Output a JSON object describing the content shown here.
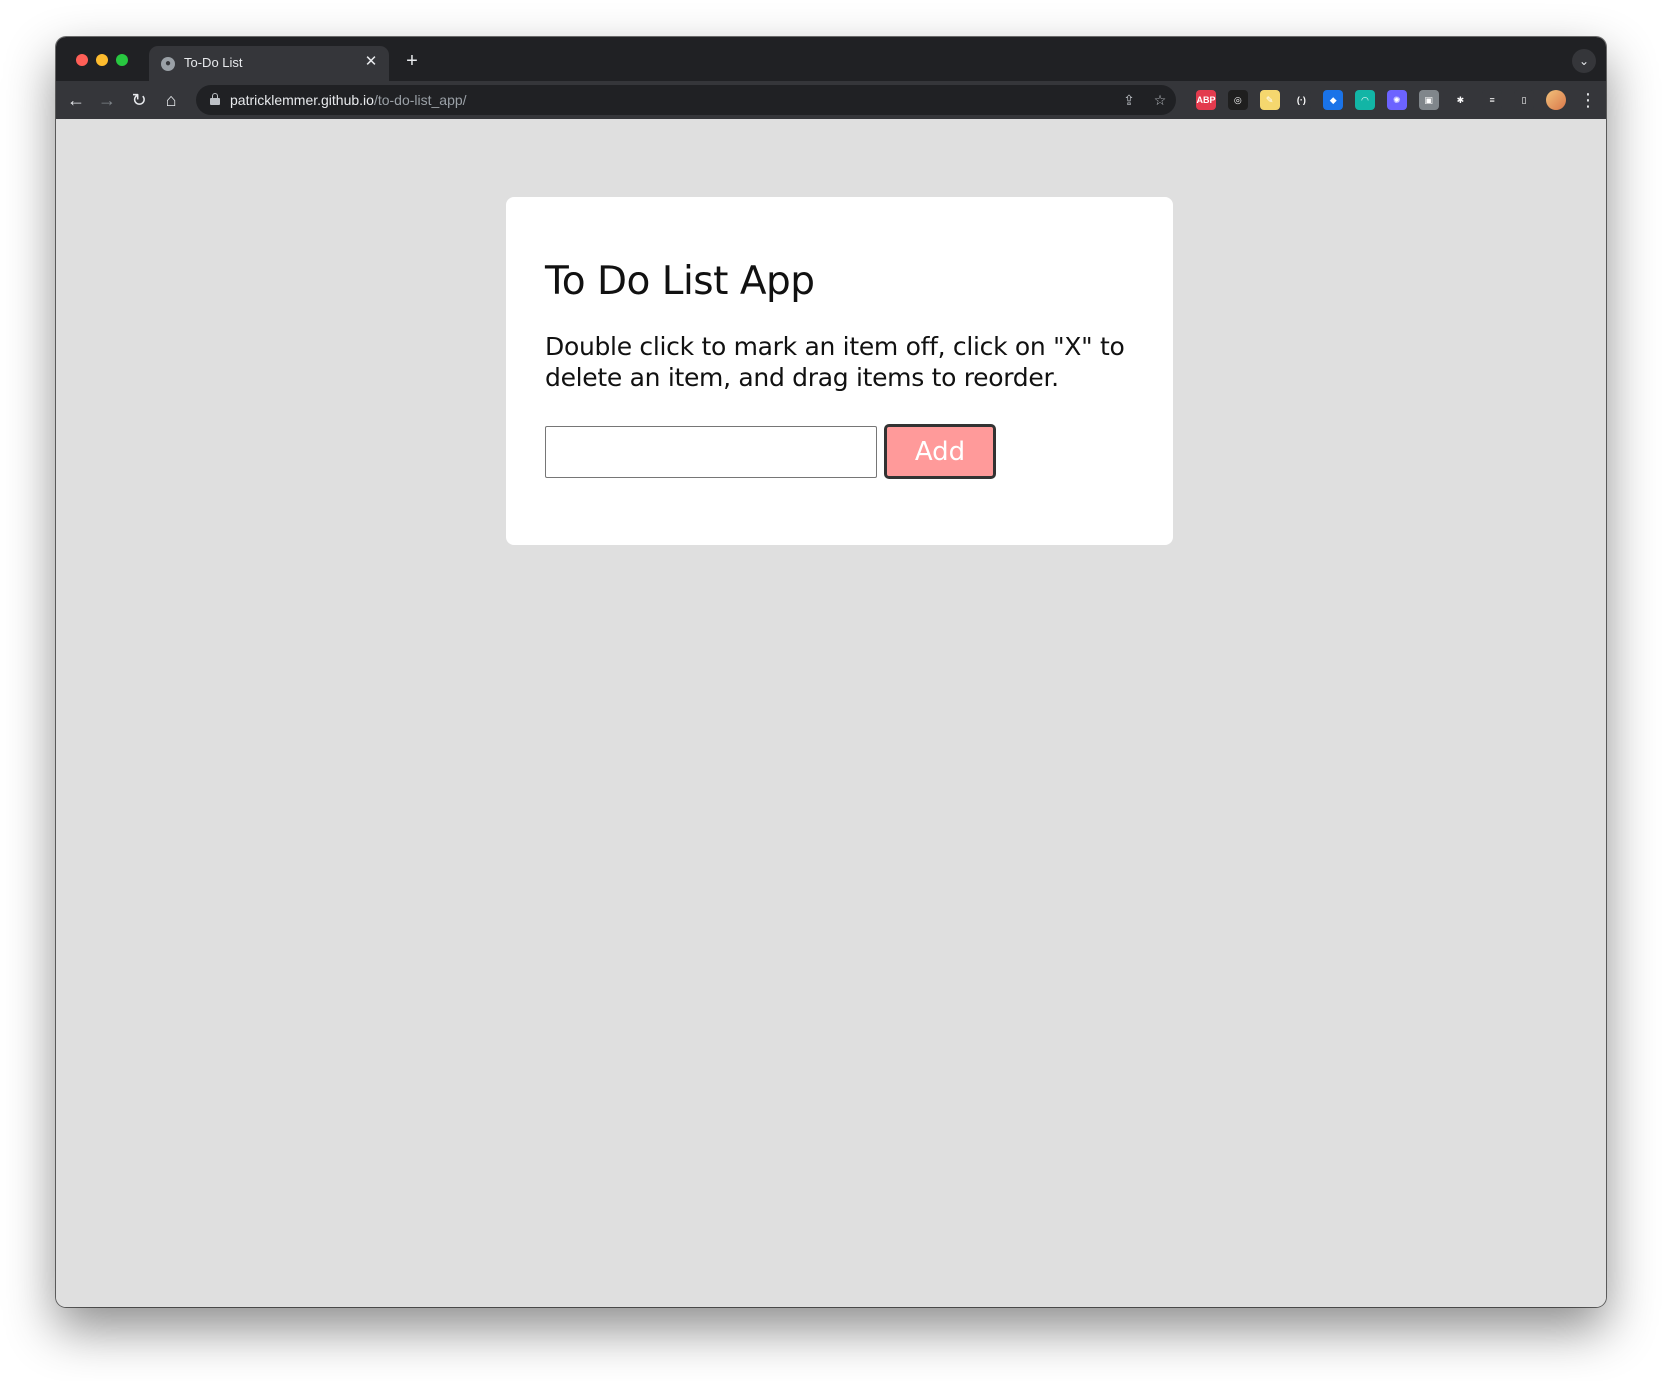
{
  "browser": {
    "tab_title": "To-Do List",
    "tab_close_glyph": "✕",
    "new_tab_glyph": "+",
    "tab_search_glyph": "⌄",
    "url_host": "patricklemmer.github.io",
    "url_path": "/to-do-list_app/",
    "nav": {
      "back": "←",
      "forward": "→",
      "reload": "↻",
      "home": "⌂"
    },
    "omnibox_icons": {
      "share": "⇪",
      "bookmark": "☆"
    },
    "extensions": [
      {
        "name": "adblock-plus-icon",
        "label": "ABP",
        "color": "#e33b4e"
      },
      {
        "name": "copilot-icon",
        "label": "◎",
        "color": "#1f1f1f"
      },
      {
        "name": "colorzilla-icon",
        "label": "✎",
        "color": "#f5d76e"
      },
      {
        "name": "devtools-ext-icon",
        "label": "(·)",
        "color": "#35363a"
      },
      {
        "name": "shield-ext-icon",
        "label": "◆",
        "color": "#1a73e8"
      },
      {
        "name": "speed-ext-icon",
        "label": "◠",
        "color": "#12b5a6"
      },
      {
        "name": "react-devtools-icon",
        "label": "✺",
        "color": "#6c63ff"
      },
      {
        "name": "screenshot-ext-icon",
        "label": "▣",
        "color": "#80868b"
      },
      {
        "name": "puzzle-icon",
        "label": "✱",
        "color": "#35363a"
      },
      {
        "name": "reading-list-icon",
        "label": "≡",
        "color": "#35363a"
      },
      {
        "name": "side-panel-icon",
        "label": "▯",
        "color": "#35363a"
      }
    ],
    "menu_glyph": "⋮"
  },
  "app": {
    "title": "To Do List App",
    "instructions": "Double click to mark an item off, click on \"X\" to delete an item, and drag items to reorder.",
    "input_value": "",
    "add_label": "Add"
  },
  "colors": {
    "button_bg": "#ff9a9a",
    "page_bg": "#dfdfdf"
  }
}
